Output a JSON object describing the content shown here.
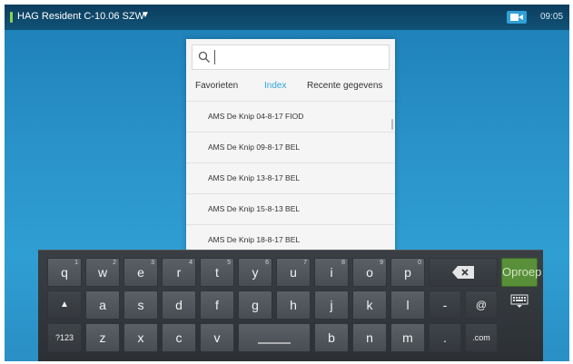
{
  "status_bar": {
    "title": "HAG Resident C-10.06 SZW",
    "caret": "▼",
    "camera_icon": "video-camera-icon",
    "time": "09:05",
    "indicator_color": "#8fd14f"
  },
  "search": {
    "value": "",
    "icon": "search-icon"
  },
  "tabs": [
    {
      "label": "Favorieten",
      "active": false
    },
    {
      "label": "Index",
      "active": true
    },
    {
      "label": "Recente gegevens",
      "active": false
    }
  ],
  "list": [
    "AMS De Knip 04-8-17 FIOD",
    "AMS De Knip 09-8-17 BEL",
    "AMS De Knip 13-8-17 BEL",
    "AMS De Knip 15-8-13 BEL",
    "AMS De Knip 18-8-17 BEL"
  ],
  "keyboard": {
    "row1": [
      {
        "label": "q",
        "hint": "1"
      },
      {
        "label": "w",
        "hint": "2"
      },
      {
        "label": "e",
        "hint": "3"
      },
      {
        "label": "r",
        "hint": "4"
      },
      {
        "label": "t",
        "hint": "5"
      },
      {
        "label": "y",
        "hint": "6"
      },
      {
        "label": "u",
        "hint": "7"
      },
      {
        "label": "i",
        "hint": "8"
      },
      {
        "label": "o",
        "hint": "9"
      },
      {
        "label": "p",
        "hint": "0"
      }
    ],
    "row2": [
      "a",
      "s",
      "d",
      "f",
      "g",
      "h",
      "j",
      "k",
      "l",
      "-",
      "@"
    ],
    "row3": [
      "z",
      "x",
      "c",
      "v",
      "b",
      "n",
      "m",
      ".",
      ".com"
    ],
    "shift": "▲",
    "numbers": "?123",
    "backspace_icon": "backspace-icon",
    "keyboard_icon": "keyboard-hide-icon",
    "call": "Oproep",
    "accent": "#2ea6dd",
    "call_color": "#5a8f3a"
  }
}
